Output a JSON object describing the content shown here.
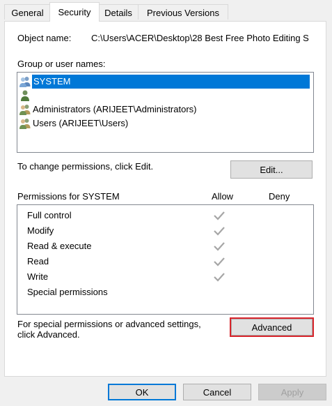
{
  "tabs": [
    {
      "label": "General",
      "active": false
    },
    {
      "label": "Security",
      "active": true
    },
    {
      "label": "Details",
      "active": false
    },
    {
      "label": "Previous Versions",
      "active": false
    }
  ],
  "object": {
    "label": "Object name:",
    "value": "C:\\Users\\ACER\\Desktop\\28 Best Free Photo Editing S"
  },
  "groups": {
    "label": "Group or user names:",
    "items": [
      {
        "name": "SYSTEM",
        "selected": true,
        "icon": "users-group-icon"
      },
      {
        "name": "",
        "selected": false,
        "icon": "user-icon"
      },
      {
        "name": "Administrators (ARIJEET\\Administrators)",
        "selected": false,
        "icon": "users-group-icon"
      },
      {
        "name": "Users (ARIJEET\\Users)",
        "selected": false,
        "icon": "users-group-icon"
      }
    ]
  },
  "edit": {
    "hint": "To change permissions, click Edit.",
    "button_label": "Edit..."
  },
  "permissions": {
    "label": "Permissions for SYSTEM",
    "allow_label": "Allow",
    "deny_label": "Deny",
    "items": [
      {
        "name": "Full control",
        "allow": true,
        "deny": false
      },
      {
        "name": "Modify",
        "allow": true,
        "deny": false
      },
      {
        "name": "Read & execute",
        "allow": true,
        "deny": false
      },
      {
        "name": "Read",
        "allow": true,
        "deny": false
      },
      {
        "name": "Write",
        "allow": true,
        "deny": false
      },
      {
        "name": "Special permissions",
        "allow": false,
        "deny": false
      }
    ]
  },
  "advanced": {
    "hint_line1": "For special permissions or advanced settings,",
    "hint_line2": "click Advanced.",
    "button_label": "Advanced"
  },
  "footer": {
    "ok_label": "OK",
    "cancel_label": "Cancel",
    "apply_label": "Apply"
  },
  "colors": {
    "selection": "#0078d7",
    "highlight_outline": "#d9252c",
    "check_gray": "#a6a6a6"
  }
}
